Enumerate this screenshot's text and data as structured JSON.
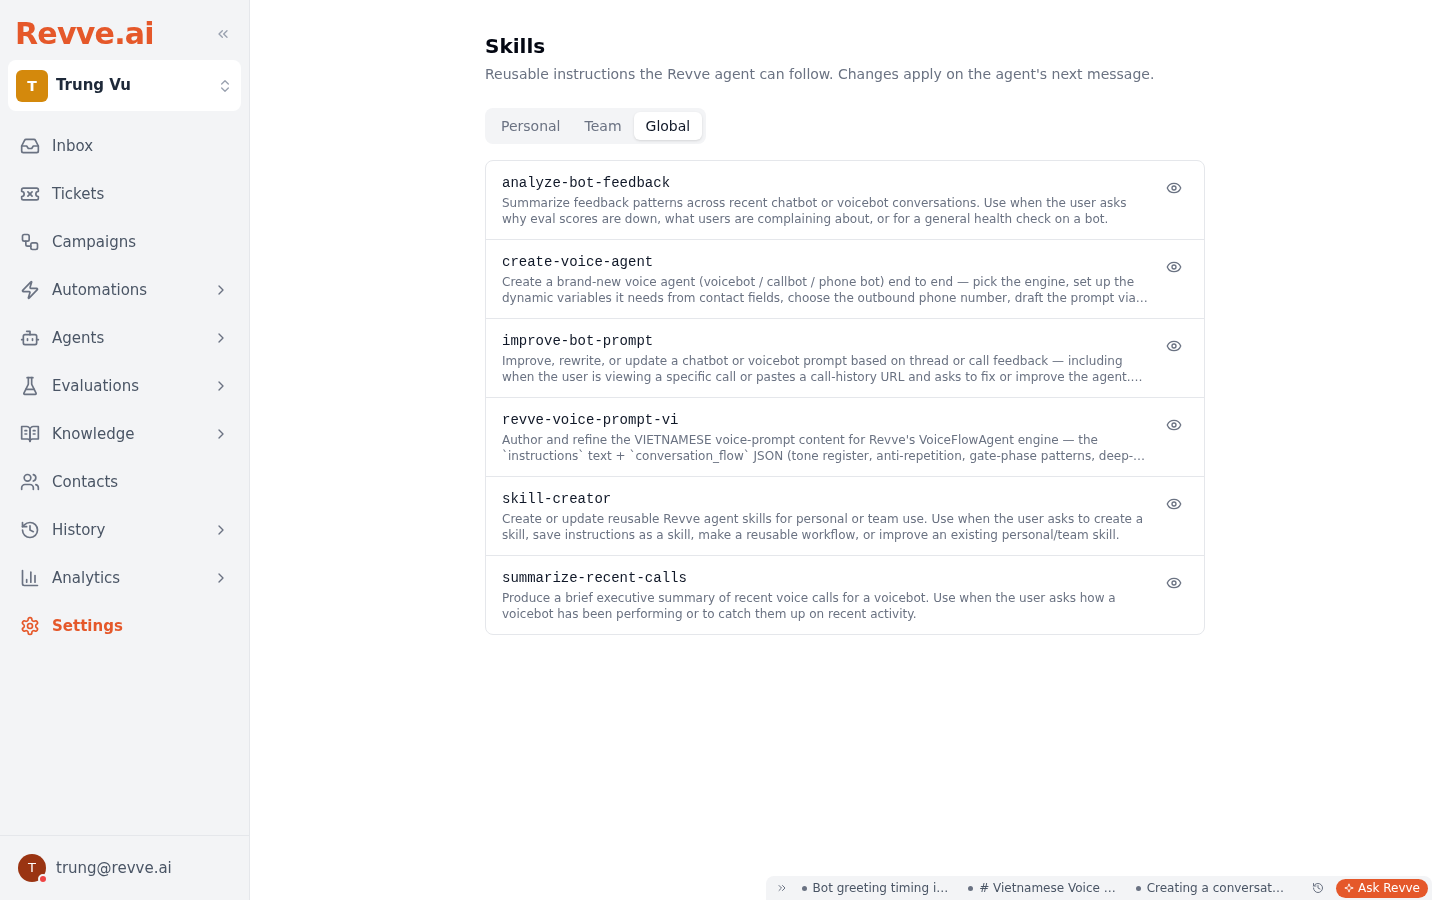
{
  "sidebar": {
    "logo": "Revve.ai",
    "workspace": {
      "initial": "T",
      "name": "Trung Vu"
    },
    "nav": [
      {
        "label": "Inbox",
        "has_submenu": false,
        "selected": false
      },
      {
        "label": "Tickets",
        "has_submenu": false,
        "selected": false
      },
      {
        "label": "Campaigns",
        "has_submenu": false,
        "selected": false
      },
      {
        "label": "Automations",
        "has_submenu": true,
        "selected": false
      },
      {
        "label": "Agents",
        "has_submenu": true,
        "selected": false
      },
      {
        "label": "Evaluations",
        "has_submenu": true,
        "selected": false
      },
      {
        "label": "Knowledge",
        "has_submenu": true,
        "selected": false
      },
      {
        "label": "Contacts",
        "has_submenu": false,
        "selected": false
      },
      {
        "label": "History",
        "has_submenu": true,
        "selected": false
      },
      {
        "label": "Analytics",
        "has_submenu": true,
        "selected": false
      },
      {
        "label": "Settings",
        "has_submenu": false,
        "selected": true
      }
    ],
    "user": {
      "initial": "T",
      "email": "trung@revve.ai",
      "notification": true
    }
  },
  "page": {
    "title": "Skills",
    "subtitle": "Reusable instructions the Revve agent can follow. Changes apply on the agent's next message.",
    "tabs": [
      {
        "label": "Personal",
        "selected": false
      },
      {
        "label": "Team",
        "selected": false
      },
      {
        "label": "Global",
        "selected": true
      }
    ],
    "skills": [
      {
        "name": "analyze-bot-feedback",
        "description": "Summarize feedback patterns across recent chatbot or voicebot conversations. Use when the user asks why eval scores are down, what users are complaining about, or for a general health check on a bot."
      },
      {
        "name": "create-voice-agent",
        "description": "Create a brand-new voice agent (voicebot / callbot / phone bot) end to end — pick the engine, set up the dynamic variables it needs from contact fields, choose the outbound phone number, draft the prompt via…"
      },
      {
        "name": "improve-bot-prompt",
        "description": "Improve, rewrite, or update a chatbot or voicebot prompt based on thread or call feedback — including when the user is viewing a specific call or pastes a call-history URL and asks to fix or improve the agent.…"
      },
      {
        "name": "revve-voice-prompt-vi",
        "description": "Author and refine the VIETNAMESE voice-prompt content for Revve's VoiceFlowAgent engine — the `instructions` text + `conversation_flow` JSON (tone register, anti-repetition, gate-phase patterns, deep-…"
      },
      {
        "name": "skill-creator",
        "description": "Create or update reusable Revve agent skills for personal or team use. Use when the user asks to create a skill, save instructions as a skill, make a reusable workflow, or improve an existing personal/team skill."
      },
      {
        "name": "summarize-recent-calls",
        "description": "Produce a brief executive summary of recent voice calls for a voicebot. Use when the user asks how a voicebot has been performing or to catch them up on recent activity."
      }
    ]
  },
  "assistant_bar": {
    "threads": [
      {
        "title": "Bot greeting timing i…"
      },
      {
        "title": "# Vietnamese Voice …"
      },
      {
        "title": "Creating a conversat…"
      }
    ],
    "ask_button": "Ask Revve"
  }
}
